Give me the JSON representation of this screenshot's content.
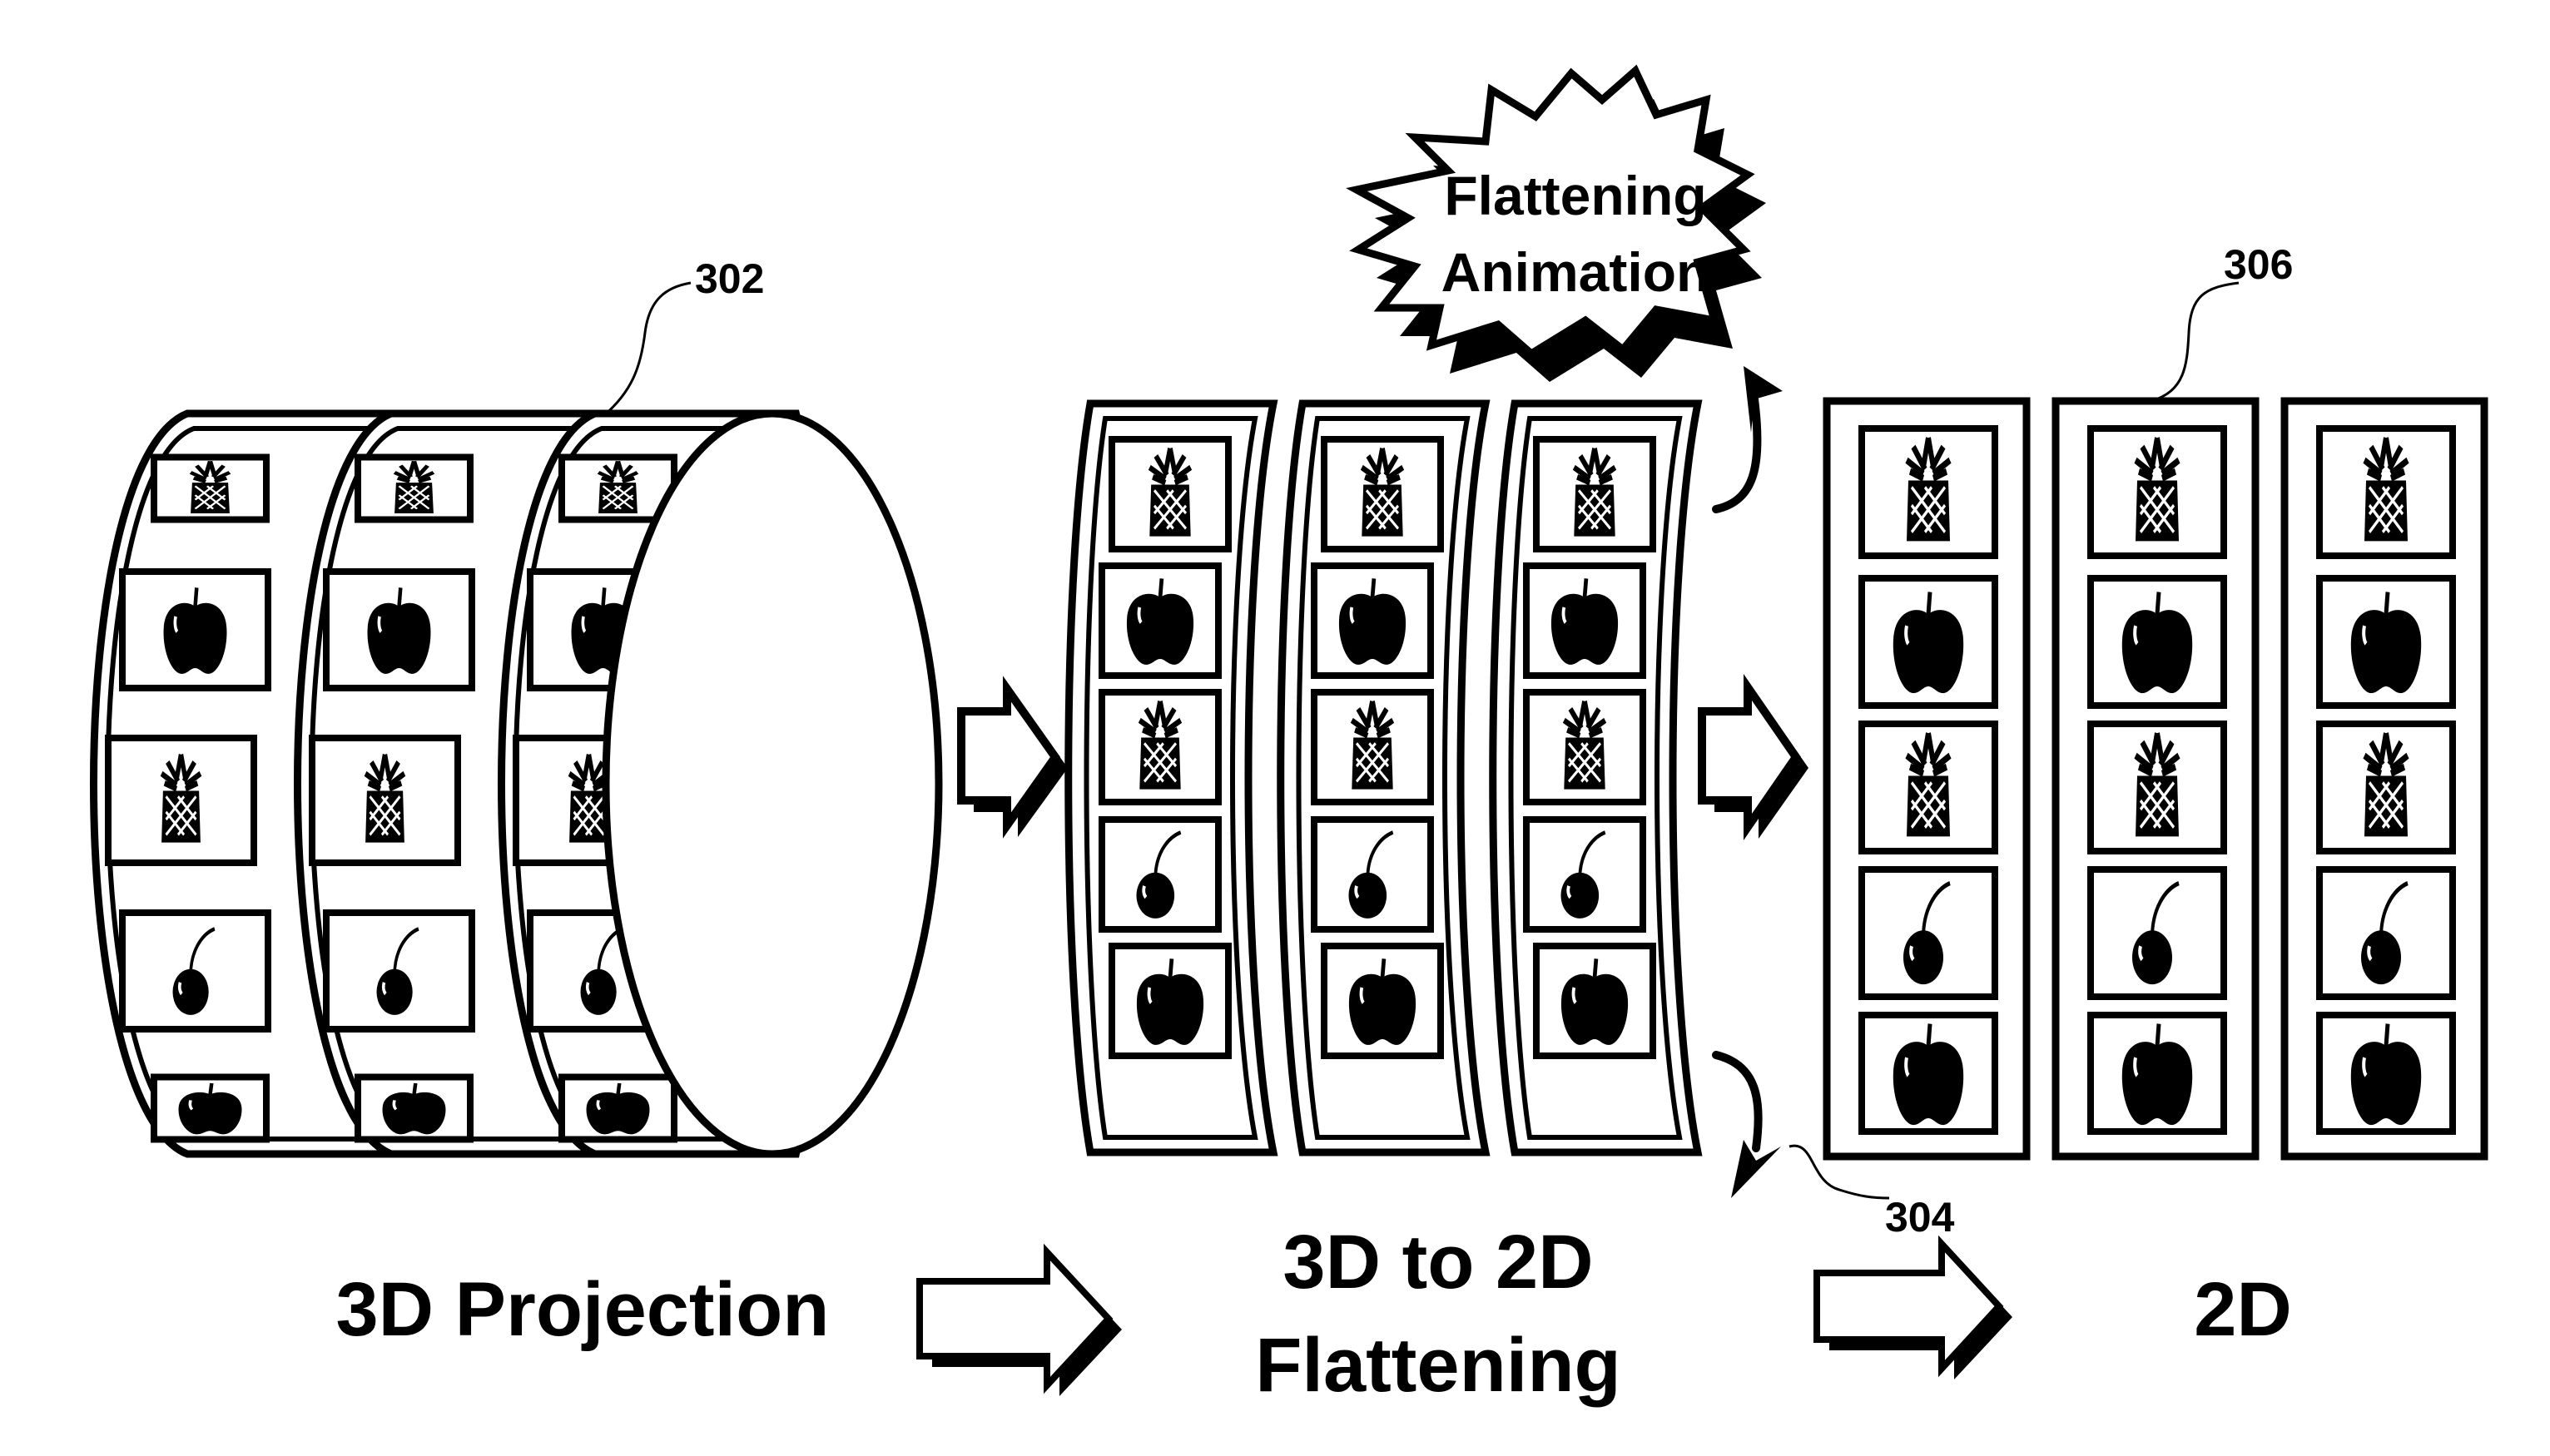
{
  "figure": {
    "colors": {
      "ink": "#000000",
      "paper": "#ffffff"
    },
    "reference_numerals": {
      "ref_302": "302",
      "ref_304": "304",
      "ref_306": "306"
    },
    "callout": {
      "line1": "Flattening",
      "line2": "Animation"
    },
    "stage_labels": {
      "projection_3d": "3D Projection",
      "flattening_line1": "3D to 2D",
      "flattening_line2": "Flattening",
      "flat_2d": "2D"
    },
    "reels": {
      "count": 3,
      "symbols_per_reel": [
        "pineapple",
        "apple",
        "pineapple",
        "cherry",
        "apple"
      ]
    }
  }
}
